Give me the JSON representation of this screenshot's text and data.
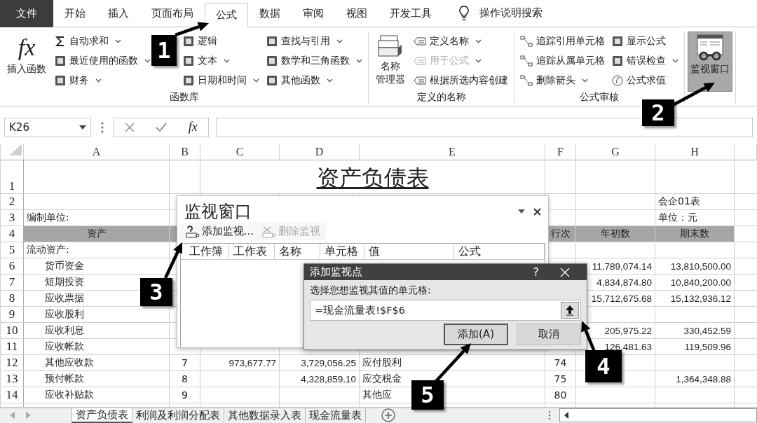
{
  "tabs": [
    {
      "label": "文件",
      "kind": "file",
      "selected": false
    },
    {
      "label": "开始",
      "kind": "tab",
      "selected": false
    },
    {
      "label": "插入",
      "kind": "tab",
      "selected": false
    },
    {
      "label": "页面布局",
      "kind": "tab",
      "selected": false
    },
    {
      "label": "公式",
      "kind": "tab",
      "selected": true
    },
    {
      "label": "数据",
      "kind": "tab",
      "selected": false
    },
    {
      "label": "审阅",
      "kind": "tab",
      "selected": false
    },
    {
      "label": "视图",
      "kind": "tab",
      "selected": false
    },
    {
      "label": "开发工具",
      "kind": "tab",
      "selected": false
    }
  ],
  "tell_me": "操作说明搜索",
  "ribbon": {
    "groups": [
      {
        "label": "函数库",
        "large": [
          {
            "label": "插入函数",
            "icon_text": "fx",
            "selected": false
          }
        ],
        "columns": [
          [
            {
              "label": "自动求和",
              "dropdown": true,
              "disabled": false
            },
            {
              "label": "最近使用的函数",
              "dropdown": true,
              "disabled": false
            },
            {
              "label": "财务",
              "dropdown": true,
              "disabled": false
            }
          ],
          [
            {
              "label": "逻辑",
              "dropdown": false,
              "disabled": false
            },
            {
              "label": "文本",
              "dropdown": true,
              "disabled": false
            },
            {
              "label": "日期和时间",
              "dropdown": true,
              "disabled": false
            }
          ],
          [
            {
              "label": "查找与引用",
              "dropdown": true,
              "disabled": false
            },
            {
              "label": "数学和三角函数",
              "dropdown": true,
              "disabled": false
            },
            {
              "label": "其他函数",
              "dropdown": true,
              "disabled": false
            }
          ]
        ]
      },
      {
        "label": "定义的名称",
        "large": [
          {
            "lines": [
              "名称",
              "管理器"
            ],
            "selected": false
          }
        ],
        "columns": [
          [
            {
              "label": "定义名称",
              "dropdown": true,
              "disabled": false
            },
            {
              "label": "用于公式",
              "dropdown": true,
              "disabled": true
            },
            {
              "label": "根据所选内容创建",
              "dropdown": false,
              "disabled": false
            }
          ]
        ]
      },
      {
        "label": "公式审核",
        "columns": [
          [
            {
              "label": "追踪引用单元格",
              "dropdown": false,
              "disabled": false
            },
            {
              "label": "追踪从属单元格",
              "dropdown": false,
              "disabled": false
            },
            {
              "label": "删除箭头",
              "dropdown": true,
              "disabled": false
            }
          ],
          [
            {
              "label": "显示公式",
              "dropdown": false,
              "disabled": false
            },
            {
              "label": "错误检查",
              "dropdown": true,
              "disabled": false
            },
            {
              "label": "公式求值",
              "dropdown": false,
              "disabled": false
            }
          ]
        ]
      },
      {
        "large": [
          {
            "label": "监视窗口",
            "selected": true
          }
        ]
      }
    ]
  },
  "formula_bar": {
    "name_box": "K26",
    "fx": "fx"
  },
  "sheet": {
    "columns": [
      "A",
      "B",
      "C",
      "D",
      "E",
      "F",
      "G",
      "H"
    ],
    "rows": [
      {
        "number": "1",
        "kind": "title",
        "title": "资产负债表",
        "cells": {}
      },
      {
        "number": "2",
        "kind": "plain",
        "cells": {
          "h": "会企01表"
        }
      },
      {
        "number": "3",
        "kind": "plain",
        "cells": {
          "a": "编制单位:",
          "h": "单位：元"
        }
      },
      {
        "number": "4",
        "kind": "header",
        "cells": {
          "a": "资产",
          "f": "行次",
          "g": "年初数",
          "h": "期末数"
        }
      },
      {
        "number": "5",
        "kind": "section",
        "cells": {
          "a": "流动资产:"
        }
      },
      {
        "number": "6",
        "kind": "item",
        "cells": {
          "a": "货币资金",
          "g": "11,789,074.14",
          "h": "13,810,500.00"
        }
      },
      {
        "number": "7",
        "kind": "item",
        "cells": {
          "a": "短期投资",
          "g": "4,834,874.80",
          "h": "10,840,200.00"
        }
      },
      {
        "number": "8",
        "kind": "item",
        "cells": {
          "a": "应收票据",
          "g": "15,712,675.68",
          "h": "15,132,936.12"
        }
      },
      {
        "number": "9",
        "kind": "item",
        "cells": {
          "a": "应收股利"
        }
      },
      {
        "number": "10",
        "kind": "item",
        "cells": {
          "a": "应收利息",
          "g": "205,975.22",
          "h": "330,452.59"
        }
      },
      {
        "number": "11",
        "kind": "item",
        "cells": {
          "a": "应收帐款",
          "g": "126,481.63",
          "h": "119,509.96"
        }
      },
      {
        "number": "12",
        "kind": "item",
        "cells": {
          "a": "其他应收款",
          "b": "7",
          "c": "973,677.77",
          "d": "3,729,056.25",
          "e": "应付股利",
          "f": "74"
        }
      },
      {
        "number": "13",
        "kind": "item",
        "cells": {
          "a": "预付帐款",
          "b": "8",
          "d": "4,328,859.10",
          "e": "应交税金",
          "f": "75",
          "h": "1,364,348.88"
        }
      },
      {
        "number": "14",
        "kind": "item",
        "cells": {
          "a": "应收补贴款",
          "b": "9",
          "e": "其他应",
          "f": "80"
        }
      }
    ]
  },
  "sheet_tabs": [
    {
      "label": "资产负债表",
      "selected": true
    },
    {
      "label": "利润及利润分配表",
      "selected": false
    },
    {
      "label": "其他数据录入表",
      "selected": false
    },
    {
      "label": "现金流量表",
      "selected": false
    }
  ],
  "watch_window": {
    "title": "监视窗口",
    "toolbar": [
      {
        "label": "添加监视...",
        "disabled": false
      },
      {
        "label": "删除监视",
        "disabled": true
      }
    ],
    "columns": [
      "工作簿",
      "工作表",
      "名称",
      "单元格",
      "值",
      "公式"
    ]
  },
  "dialog": {
    "title": "添加监视点",
    "help": "?",
    "prompt": "选择您想监视其值的单元格:",
    "value": "=现金流量表!$F$6",
    "buttons": [
      {
        "label": "添加(A)",
        "selected": true
      },
      {
        "label": "取消",
        "selected": false
      }
    ]
  },
  "callouts": [
    {
      "label": "1"
    },
    {
      "label": "2"
    },
    {
      "label": "3"
    },
    {
      "label": "4"
    },
    {
      "label": "5"
    }
  ]
}
